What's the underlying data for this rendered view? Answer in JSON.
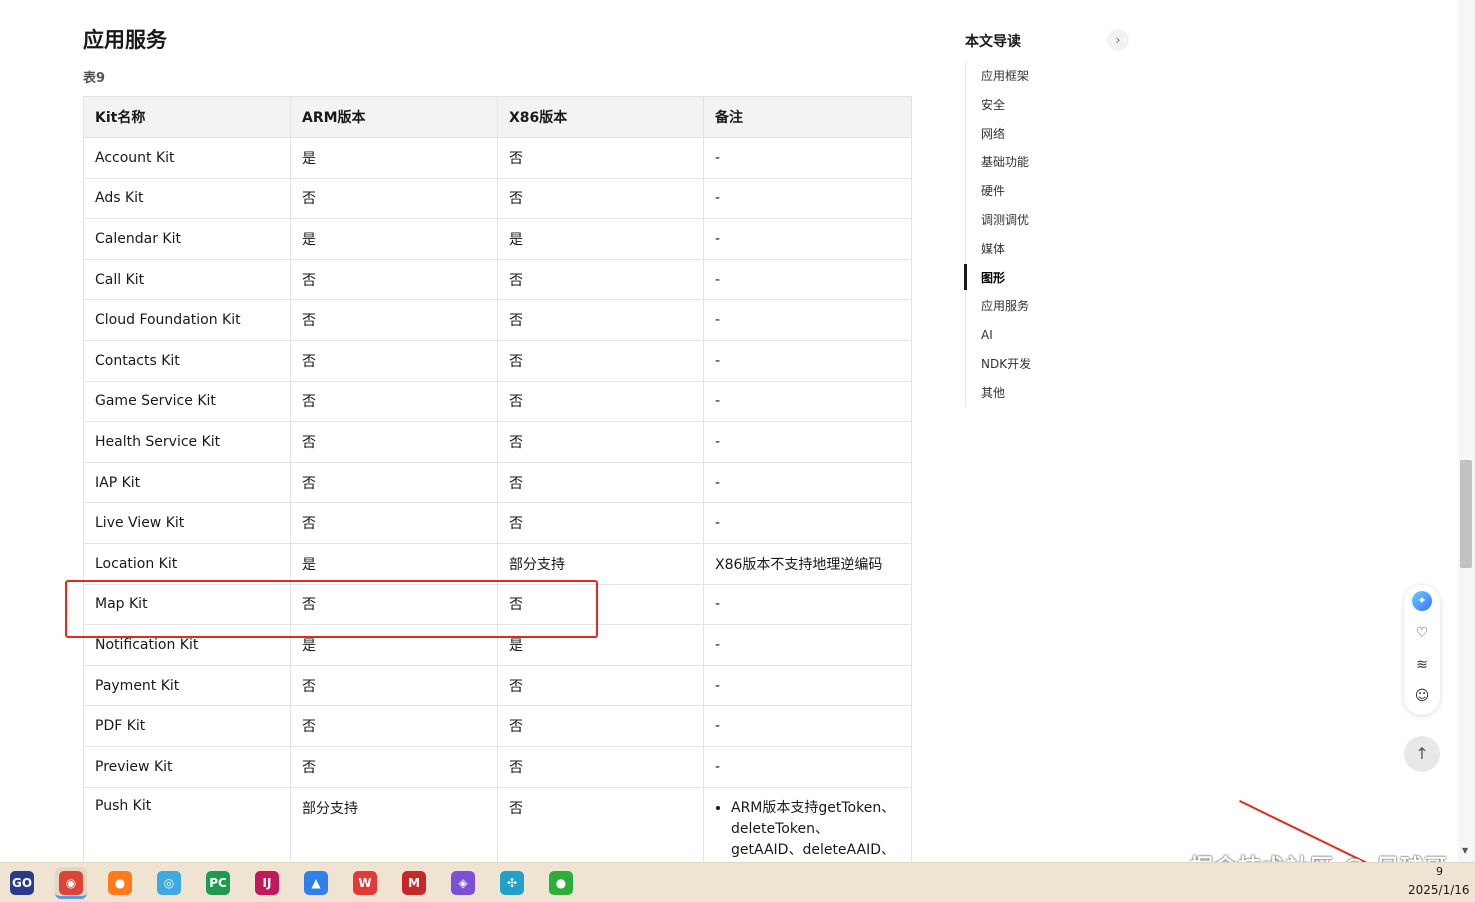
{
  "section": {
    "title": "应用服务",
    "caption": "表9"
  },
  "table": {
    "headers": [
      "Kit名称",
      "ARM版本",
      "X86版本",
      "备注"
    ],
    "rows": [
      [
        "Account Kit",
        "是",
        "否",
        "-"
      ],
      [
        "Ads Kit",
        "否",
        "否",
        "-"
      ],
      [
        "Calendar Kit",
        "是",
        "是",
        "-"
      ],
      [
        "Call Kit",
        "否",
        "否",
        "-"
      ],
      [
        "Cloud Foundation Kit",
        "否",
        "否",
        "-"
      ],
      [
        "Contacts Kit",
        "否",
        "否",
        "-"
      ],
      [
        "Game Service Kit",
        "否",
        "否",
        "-"
      ],
      [
        "Health Service Kit",
        "否",
        "否",
        "-"
      ],
      [
        "IAP Kit",
        "否",
        "否",
        "-"
      ],
      [
        "Live View Kit",
        "否",
        "否",
        "-"
      ],
      [
        "Location Kit",
        "是",
        "部分支持",
        "X86版本不支持地理逆编码"
      ],
      [
        "Map Kit",
        "否",
        "否",
        "-"
      ],
      [
        "Notification Kit",
        "是",
        "是",
        "-"
      ],
      [
        "Payment Kit",
        "否",
        "否",
        "-"
      ],
      [
        "PDF Kit",
        "否",
        "否",
        "-"
      ],
      [
        "Preview Kit",
        "否",
        "否",
        "-"
      ]
    ],
    "last_row": {
      "name": "Push Kit",
      "arm": "部分支持",
      "x86": "否",
      "note_bullet": "ARM版本支持getToken、deleteToken、getAAID、deleteAAID、"
    }
  },
  "toc": {
    "title": "本文导读",
    "expand_icon": "chevron-right-icon",
    "items": [
      "应用框架",
      "安全",
      "网络",
      "基础功能",
      "硬件",
      "调测调优",
      "媒体",
      "图形",
      "应用服务",
      "AI",
      "NDK开发",
      "其他"
    ],
    "active_index": 7
  },
  "floating_tools": {
    "icons": [
      "ai-assistant-icon",
      "heart-link-icon",
      "layers-icon",
      "smiley-icon"
    ],
    "back_to_top_icon": "arrow-up-icon"
  },
  "watermark": "掘金技术社区 @ 足球哥",
  "taskbar": {
    "apps": [
      {
        "name": "goland-icon",
        "glyph": "GO",
        "color": "#2a3b8f"
      },
      {
        "name": "chrome-icon",
        "glyph": "◉",
        "color": "#db4437"
      },
      {
        "name": "firefox-icon",
        "glyph": "●",
        "color": "#ff7a1a"
      },
      {
        "name": "browser-icon",
        "glyph": "◎",
        "color": "#3ea8e0"
      },
      {
        "name": "pycharm-icon",
        "glyph": "PC",
        "color": "#1f9b4d"
      },
      {
        "name": "intellij-icon",
        "glyph": "IJ",
        "color": "#c2185b"
      },
      {
        "name": "drive-icon",
        "glyph": "▲",
        "color": "#2f80ed"
      },
      {
        "name": "wps-icon",
        "glyph": "W",
        "color": "#e53935"
      },
      {
        "name": "mcafee-icon",
        "glyph": "M",
        "color": "#c62828"
      },
      {
        "name": "app-icon",
        "glyph": "◈",
        "color": "#7b4fd8"
      },
      {
        "name": "pinwheel-icon",
        "glyph": "✣",
        "color": "#21a0c9"
      },
      {
        "name": "wechat-icon",
        "glyph": "●",
        "color": "#2bae3a"
      }
    ],
    "active_index": 1,
    "date": "2025/1/16",
    "time_fragment": "9"
  },
  "colors": {
    "highlight": "#e8281f",
    "header_bg": "#f1f3f5",
    "taskbar_bg": "#efe3d2"
  }
}
